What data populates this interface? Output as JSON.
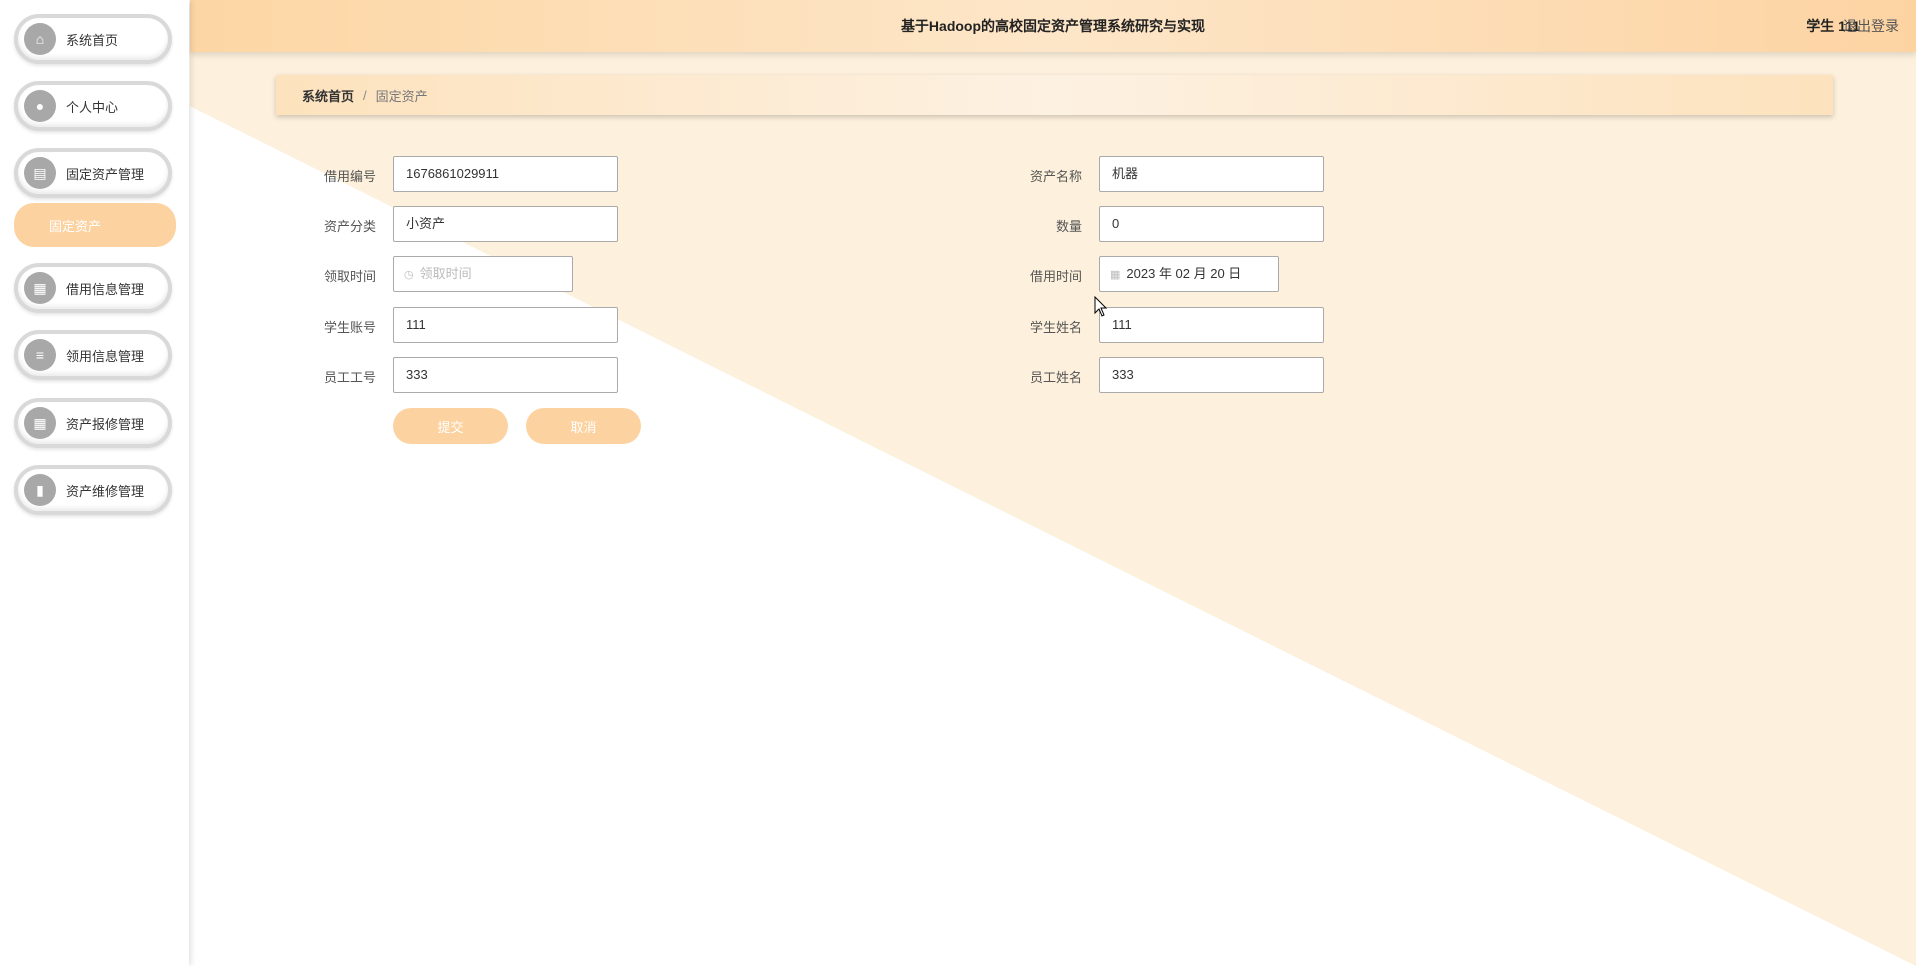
{
  "header": {
    "title": "基于Hadoop的高校固定资产管理系统研究与实现",
    "user": "学生 111",
    "logout": "退出登录"
  },
  "sidebar": {
    "items": [
      {
        "label": "系统首页",
        "icon": "home-icon"
      },
      {
        "label": "个人中心",
        "icon": "user-icon"
      },
      {
        "label": "固定资产管理",
        "icon": "clipboard-icon"
      },
      {
        "label": "借用信息管理",
        "icon": "grid-icon"
      },
      {
        "label": "领用信息管理",
        "icon": "list-icon"
      },
      {
        "label": "资产报修管理",
        "icon": "grid-icon"
      },
      {
        "label": "资产维修管理",
        "icon": "book-icon"
      }
    ],
    "submenu": "固定资产"
  },
  "breadcrumb": {
    "home": "系统首页",
    "separator": "/",
    "current": "固定资产"
  },
  "form": {
    "borrow_no": {
      "label": "借用编号",
      "value": "1676861029911"
    },
    "asset_name": {
      "label": "资产名称",
      "value": "机器"
    },
    "category": {
      "label": "资产分类",
      "value": "小资产"
    },
    "quantity": {
      "label": "数量",
      "value": "0"
    },
    "receive_time": {
      "label": "领取时间",
      "placeholder": "领取时间"
    },
    "borrow_time": {
      "label": "借用时间",
      "value": "2023 年 02 月 20 日"
    },
    "student_account": {
      "label": "学生账号",
      "value": "111"
    },
    "student_name": {
      "label": "学生姓名",
      "value": "111"
    },
    "staff_no": {
      "label": "员工工号",
      "value": "333"
    },
    "staff_name": {
      "label": "员工姓名",
      "value": "333"
    },
    "submit": "提交",
    "cancel": "取消"
  },
  "colors": {
    "accent": "#fcd3a0",
    "header_gradient_start": "#fdd6a4",
    "background_triangle": "#fdf0dc"
  }
}
